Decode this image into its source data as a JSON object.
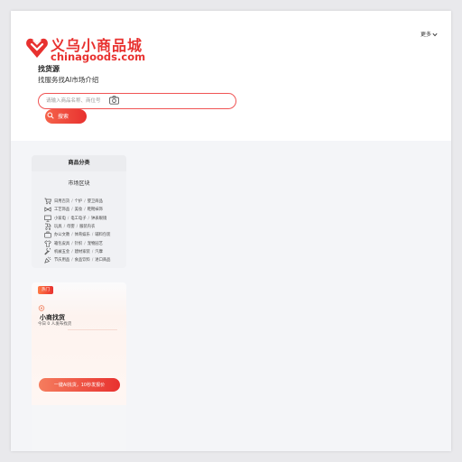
{
  "brand": {
    "name_cn": "义乌小商品城",
    "domain": "chinagoods.com",
    "color": "#e8312f"
  },
  "header": {
    "more_label": "更多"
  },
  "intro": {
    "title": "找货源",
    "subtitle": "找服务找AI市场介绍"
  },
  "search": {
    "placeholder": "请输入商品名称、商位号",
    "button_label": "搜索"
  },
  "categories": {
    "panel_title": "商品分类",
    "market_title": "市场区块",
    "rows": [
      {
        "icon": "shopping-cart-icon",
        "items": [
          "日用百货",
          "个护",
          "婴卫商品"
        ]
      },
      {
        "icon": "ribbon-bow-icon",
        "items": [
          "工艺饰品",
          "美妆",
          "鞋靴袜饰"
        ]
      },
      {
        "icon": "monitor-icon",
        "items": [
          "小家电",
          "电工电子",
          "钟表眼镜"
        ]
      },
      {
        "icon": "baby-stroller-icon",
        "items": [
          "玩具",
          "母婴",
          "服装内衣"
        ]
      },
      {
        "icon": "briefcase-icon",
        "items": [
          "办公文教",
          "体育娱乐",
          "辅料包装"
        ]
      },
      {
        "icon": "shirt-icon",
        "items": [
          "箱包皮具",
          "针织",
          "宠物园艺"
        ]
      },
      {
        "icon": "wrench-icon",
        "items": [
          "机械五金",
          "建材家装",
          "汽摩"
        ]
      },
      {
        "icon": "party-popper-icon",
        "items": [
          "节庆用品",
          "食品饮料",
          "进口商品"
        ]
      }
    ]
  },
  "hot_card": {
    "badge": "热门",
    "title": "小商找货",
    "subtitle": "今日 0 人发布找货",
    "button_label": "一键AI找货，10秒发报价"
  }
}
